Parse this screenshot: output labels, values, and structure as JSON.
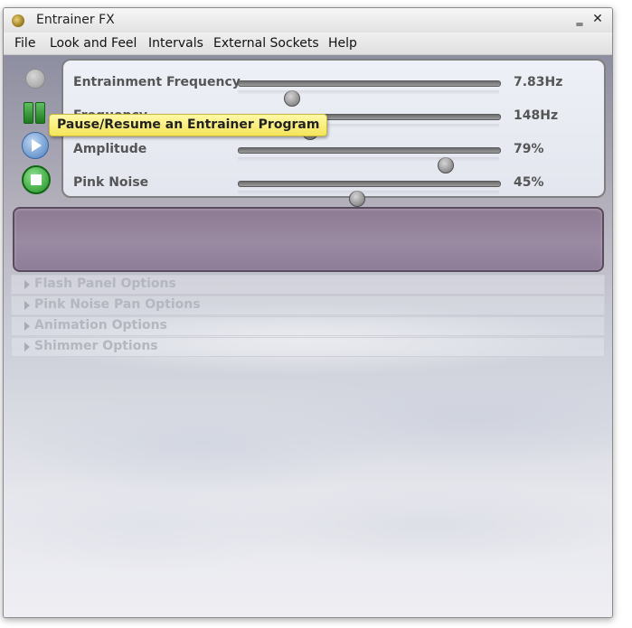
{
  "window": {
    "title": "Entrainer FX",
    "minimize_glyph": "‗",
    "close_glyph": "✕"
  },
  "menu": {
    "items": [
      {
        "label": "File"
      },
      {
        "label": "Look and Feel"
      },
      {
        "label": "Intervals"
      },
      {
        "label": "External Sockets"
      },
      {
        "label": "Help"
      }
    ]
  },
  "controls": {
    "record_icon": "record-icon",
    "pause_icon": "pause-icon",
    "play_icon": "play-icon",
    "stop_icon": "stop-icon"
  },
  "sliders": [
    {
      "label": "Entrainment Frequency",
      "value_text": "7.83Hz",
      "level": 0.2
    },
    {
      "label": "Frequency",
      "value_text": "148Hz",
      "level": 0.27
    },
    {
      "label": "Amplitude",
      "value_text": "79%",
      "level": 0.79
    },
    {
      "label": "Pink Noise",
      "value_text": "45%",
      "level": 0.45
    }
  ],
  "tooltip": {
    "text": "Pause/Resume an Entrainer Program"
  },
  "options": [
    {
      "label": "Flash Panel Options"
    },
    {
      "label": "Pink Noise Pan Options"
    },
    {
      "label": "Animation Options"
    },
    {
      "label": "Shimmer Options"
    }
  ],
  "colors": {
    "flash_panel": "#9380a0",
    "tooltip_bg": "#f7ec7a",
    "pause_green": "#3aa33a",
    "play_blue": "#5b8fd0",
    "stop_green": "#2a9c2e"
  }
}
